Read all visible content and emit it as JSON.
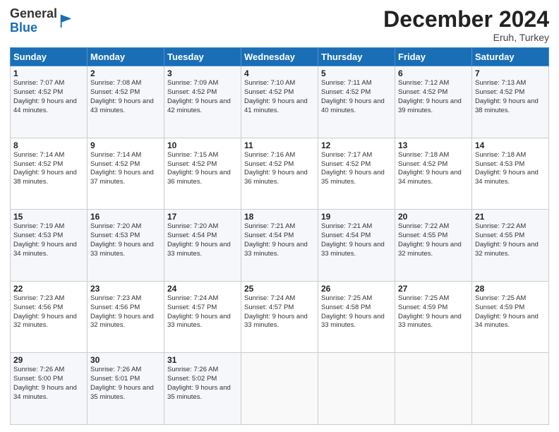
{
  "logo": {
    "general": "General",
    "blue": "Blue"
  },
  "header": {
    "title": "December 2024",
    "location": "Eruh, Turkey"
  },
  "columns": [
    "Sunday",
    "Monday",
    "Tuesday",
    "Wednesday",
    "Thursday",
    "Friday",
    "Saturday"
  ],
  "weeks": [
    [
      {
        "day": "1",
        "sunrise": "Sunrise: 7:07 AM",
        "sunset": "Sunset: 4:52 PM",
        "daylight": "Daylight: 9 hours and 44 minutes."
      },
      {
        "day": "2",
        "sunrise": "Sunrise: 7:08 AM",
        "sunset": "Sunset: 4:52 PM",
        "daylight": "Daylight: 9 hours and 43 minutes."
      },
      {
        "day": "3",
        "sunrise": "Sunrise: 7:09 AM",
        "sunset": "Sunset: 4:52 PM",
        "daylight": "Daylight: 9 hours and 42 minutes."
      },
      {
        "day": "4",
        "sunrise": "Sunrise: 7:10 AM",
        "sunset": "Sunset: 4:52 PM",
        "daylight": "Daylight: 9 hours and 41 minutes."
      },
      {
        "day": "5",
        "sunrise": "Sunrise: 7:11 AM",
        "sunset": "Sunset: 4:52 PM",
        "daylight": "Daylight: 9 hours and 40 minutes."
      },
      {
        "day": "6",
        "sunrise": "Sunrise: 7:12 AM",
        "sunset": "Sunset: 4:52 PM",
        "daylight": "Daylight: 9 hours and 39 minutes."
      },
      {
        "day": "7",
        "sunrise": "Sunrise: 7:13 AM",
        "sunset": "Sunset: 4:52 PM",
        "daylight": "Daylight: 9 hours and 38 minutes."
      }
    ],
    [
      {
        "day": "8",
        "sunrise": "Sunrise: 7:14 AM",
        "sunset": "Sunset: 4:52 PM",
        "daylight": "Daylight: 9 hours and 38 minutes."
      },
      {
        "day": "9",
        "sunrise": "Sunrise: 7:14 AM",
        "sunset": "Sunset: 4:52 PM",
        "daylight": "Daylight: 9 hours and 37 minutes."
      },
      {
        "day": "10",
        "sunrise": "Sunrise: 7:15 AM",
        "sunset": "Sunset: 4:52 PM",
        "daylight": "Daylight: 9 hours and 36 minutes."
      },
      {
        "day": "11",
        "sunrise": "Sunrise: 7:16 AM",
        "sunset": "Sunset: 4:52 PM",
        "daylight": "Daylight: 9 hours and 36 minutes."
      },
      {
        "day": "12",
        "sunrise": "Sunrise: 7:17 AM",
        "sunset": "Sunset: 4:52 PM",
        "daylight": "Daylight: 9 hours and 35 minutes."
      },
      {
        "day": "13",
        "sunrise": "Sunrise: 7:18 AM",
        "sunset": "Sunset: 4:52 PM",
        "daylight": "Daylight: 9 hours and 34 minutes."
      },
      {
        "day": "14",
        "sunrise": "Sunrise: 7:18 AM",
        "sunset": "Sunset: 4:53 PM",
        "daylight": "Daylight: 9 hours and 34 minutes."
      }
    ],
    [
      {
        "day": "15",
        "sunrise": "Sunrise: 7:19 AM",
        "sunset": "Sunset: 4:53 PM",
        "daylight": "Daylight: 9 hours and 34 minutes."
      },
      {
        "day": "16",
        "sunrise": "Sunrise: 7:20 AM",
        "sunset": "Sunset: 4:53 PM",
        "daylight": "Daylight: 9 hours and 33 minutes."
      },
      {
        "day": "17",
        "sunrise": "Sunrise: 7:20 AM",
        "sunset": "Sunset: 4:54 PM",
        "daylight": "Daylight: 9 hours and 33 minutes."
      },
      {
        "day": "18",
        "sunrise": "Sunrise: 7:21 AM",
        "sunset": "Sunset: 4:54 PM",
        "daylight": "Daylight: 9 hours and 33 minutes."
      },
      {
        "day": "19",
        "sunrise": "Sunrise: 7:21 AM",
        "sunset": "Sunset: 4:54 PM",
        "daylight": "Daylight: 9 hours and 33 minutes."
      },
      {
        "day": "20",
        "sunrise": "Sunrise: 7:22 AM",
        "sunset": "Sunset: 4:55 PM",
        "daylight": "Daylight: 9 hours and 32 minutes."
      },
      {
        "day": "21",
        "sunrise": "Sunrise: 7:22 AM",
        "sunset": "Sunset: 4:55 PM",
        "daylight": "Daylight: 9 hours and 32 minutes."
      }
    ],
    [
      {
        "day": "22",
        "sunrise": "Sunrise: 7:23 AM",
        "sunset": "Sunset: 4:56 PM",
        "daylight": "Daylight: 9 hours and 32 minutes."
      },
      {
        "day": "23",
        "sunrise": "Sunrise: 7:23 AM",
        "sunset": "Sunset: 4:56 PM",
        "daylight": "Daylight: 9 hours and 32 minutes."
      },
      {
        "day": "24",
        "sunrise": "Sunrise: 7:24 AM",
        "sunset": "Sunset: 4:57 PM",
        "daylight": "Daylight: 9 hours and 33 minutes."
      },
      {
        "day": "25",
        "sunrise": "Sunrise: 7:24 AM",
        "sunset": "Sunset: 4:57 PM",
        "daylight": "Daylight: 9 hours and 33 minutes."
      },
      {
        "day": "26",
        "sunrise": "Sunrise: 7:25 AM",
        "sunset": "Sunset: 4:58 PM",
        "daylight": "Daylight: 9 hours and 33 minutes."
      },
      {
        "day": "27",
        "sunrise": "Sunrise: 7:25 AM",
        "sunset": "Sunset: 4:59 PM",
        "daylight": "Daylight: 9 hours and 33 minutes."
      },
      {
        "day": "28",
        "sunrise": "Sunrise: 7:25 AM",
        "sunset": "Sunset: 4:59 PM",
        "daylight": "Daylight: 9 hours and 34 minutes."
      }
    ],
    [
      {
        "day": "29",
        "sunrise": "Sunrise: 7:26 AM",
        "sunset": "Sunset: 5:00 PM",
        "daylight": "Daylight: 9 hours and 34 minutes."
      },
      {
        "day": "30",
        "sunrise": "Sunrise: 7:26 AM",
        "sunset": "Sunset: 5:01 PM",
        "daylight": "Daylight: 9 hours and 35 minutes."
      },
      {
        "day": "31",
        "sunrise": "Sunrise: 7:26 AM",
        "sunset": "Sunset: 5:02 PM",
        "daylight": "Daylight: 9 hours and 35 minutes."
      },
      null,
      null,
      null,
      null
    ]
  ]
}
